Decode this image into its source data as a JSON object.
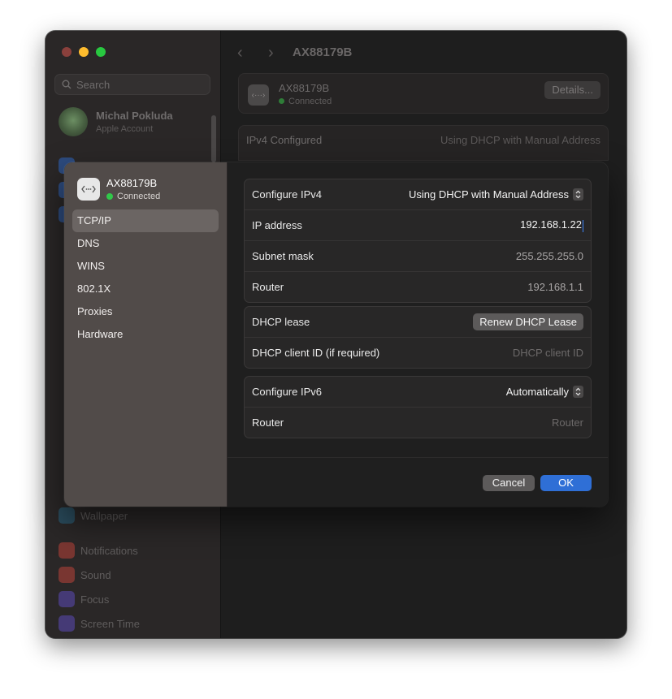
{
  "window": {
    "traffic": {
      "close_color": "#ff5f57",
      "min_color": "#febc2e",
      "max_color": "#28c840"
    },
    "search_placeholder": "Search",
    "account": {
      "name": "Michal Pokluda",
      "subtitle": "Apple Account"
    },
    "sidebar_items": [
      {
        "label": "Wallpaper",
        "icon": "wallpaper-icon",
        "color": "#2a6a88"
      },
      {
        "label": "Notifications",
        "icon": "bell-icon",
        "color": "#b9443b"
      },
      {
        "label": "Sound",
        "icon": "speaker-icon",
        "color": "#b9443b"
      },
      {
        "label": "Focus",
        "icon": "moon-icon",
        "color": "#5b4bb8"
      },
      {
        "label": "Screen Time",
        "icon": "hourglass-icon",
        "color": "#5b4bb8"
      }
    ],
    "main": {
      "title": "AX88179B",
      "device_name": "AX88179B",
      "device_status": "Connected",
      "details_button": "Details...",
      "ipv4_label": "IPv4 Configured",
      "ipv4_value": "Using DHCP with Manual Address"
    }
  },
  "dialog": {
    "device_name": "AX88179B",
    "device_status": "Connected",
    "menu": [
      "TCP/IP",
      "DNS",
      "WINS",
      "802.1X",
      "Proxies",
      "Hardware"
    ],
    "selected_menu": "TCP/IP",
    "ipv4_group": {
      "configure_label": "Configure IPv4",
      "configure_value": "Using DHCP with Manual Address",
      "ip_label": "IP address",
      "ip_value": "192.168.1.22",
      "subnet_label": "Subnet mask",
      "subnet_value": "255.255.255.0",
      "router_label": "Router",
      "router_value": "192.168.1.1"
    },
    "dhcp_group": {
      "lease_label": "DHCP lease",
      "renew_button": "Renew DHCP Lease",
      "client_label": "DHCP client ID (if required)",
      "client_placeholder": "DHCP client ID"
    },
    "ipv6_group": {
      "configure_label": "Configure IPv6",
      "configure_value": "Automatically",
      "router_label": "Router",
      "router_placeholder": "Router"
    },
    "cancel_button": "Cancel",
    "ok_button": "OK",
    "accent_color": "#2f6fd6"
  }
}
